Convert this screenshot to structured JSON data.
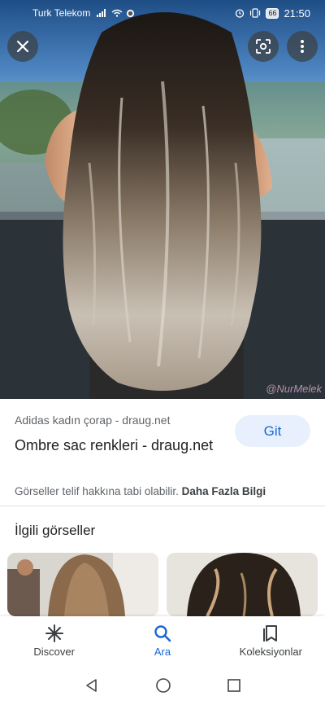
{
  "status_bar": {
    "carrier": "Turk Telekom",
    "battery": "66",
    "time": "21:50"
  },
  "hero": {
    "watermark": "@NurMelek"
  },
  "result": {
    "source": "Adidas kadın çorap - draug.net",
    "title": "Ombre sac renkleri - draug.net",
    "visit_label": "Git",
    "copyright_text": "Görseller telif hakkına tabi olabilir.",
    "more_info_label": "Daha Fazla Bilgi"
  },
  "related": {
    "heading": "İlgili görseller"
  },
  "bottom_nav": {
    "items": [
      {
        "label": "Discover",
        "icon": "asterisk-icon"
      },
      {
        "label": "Ara",
        "icon": "search-icon"
      },
      {
        "label": "Koleksiyonlar",
        "icon": "collections-icon"
      }
    ]
  },
  "colors": {
    "accent": "#1967d2",
    "visit_bg": "#e8f0fe",
    "secondary_text": "#5f6368"
  }
}
